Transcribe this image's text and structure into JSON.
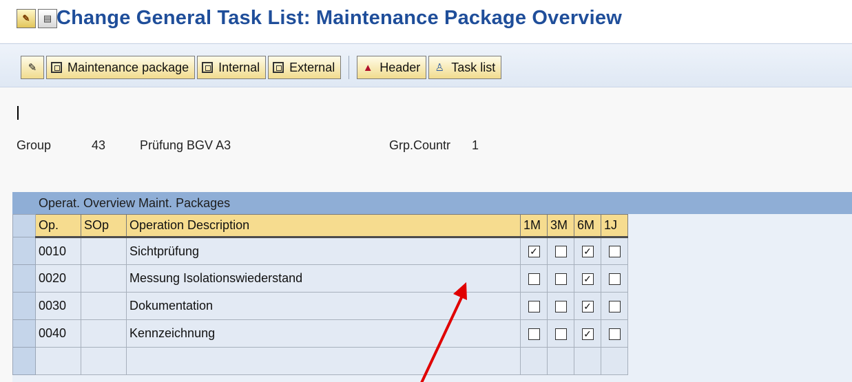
{
  "window": {
    "title": "Change General Task List: Maintenance Package Overview"
  },
  "toolbar": {
    "buttons": [
      {
        "label": ""
      },
      {
        "label": "Maintenance package"
      },
      {
        "label": "Internal"
      },
      {
        "label": "External"
      },
      {
        "label": "Header"
      },
      {
        "label": "Task list"
      }
    ]
  },
  "header_info": {
    "group_label": "Group",
    "group_value": "43",
    "group_text": "Prüfung BGV A3",
    "counter_label": "Grp.Countr",
    "counter_value": "1"
  },
  "panel": {
    "title": "Operat. Overview Maint. Packages",
    "columns": [
      "Op.",
      "SOp",
      "Operation Description",
      "1M",
      "3M",
      "6M",
      "1J"
    ],
    "rows": [
      {
        "op": "0010",
        "sop": "",
        "desc": "Sichtprüfung",
        "checks": [
          true,
          false,
          true,
          false
        ]
      },
      {
        "op": "0020",
        "sop": "",
        "desc": "Messung Isolationswiederstand",
        "checks": [
          false,
          false,
          true,
          false
        ]
      },
      {
        "op": "0030",
        "sop": "",
        "desc": "Dokumentation",
        "checks": [
          false,
          false,
          true,
          false
        ]
      },
      {
        "op": "0040",
        "sop": "",
        "desc": "Kennzeichnung",
        "checks": [
          false,
          false,
          true,
          false
        ]
      },
      {
        "op": "",
        "sop": "",
        "desc": "",
        "checks": [
          null,
          null,
          null,
          null
        ]
      }
    ]
  },
  "colors": {
    "title_blue": "#1f4e9a",
    "panel_header": "#8faed6",
    "column_header": "#f6dc8f",
    "annotation_arrow": "#e00000"
  },
  "icons": {
    "title_icons": [
      "display-change-icon",
      "document-icon"
    ],
    "toolbar_icons": [
      "edit-icon",
      "package-icon",
      "package-icon",
      "package-icon",
      "hat-icon",
      "person-icon"
    ]
  }
}
